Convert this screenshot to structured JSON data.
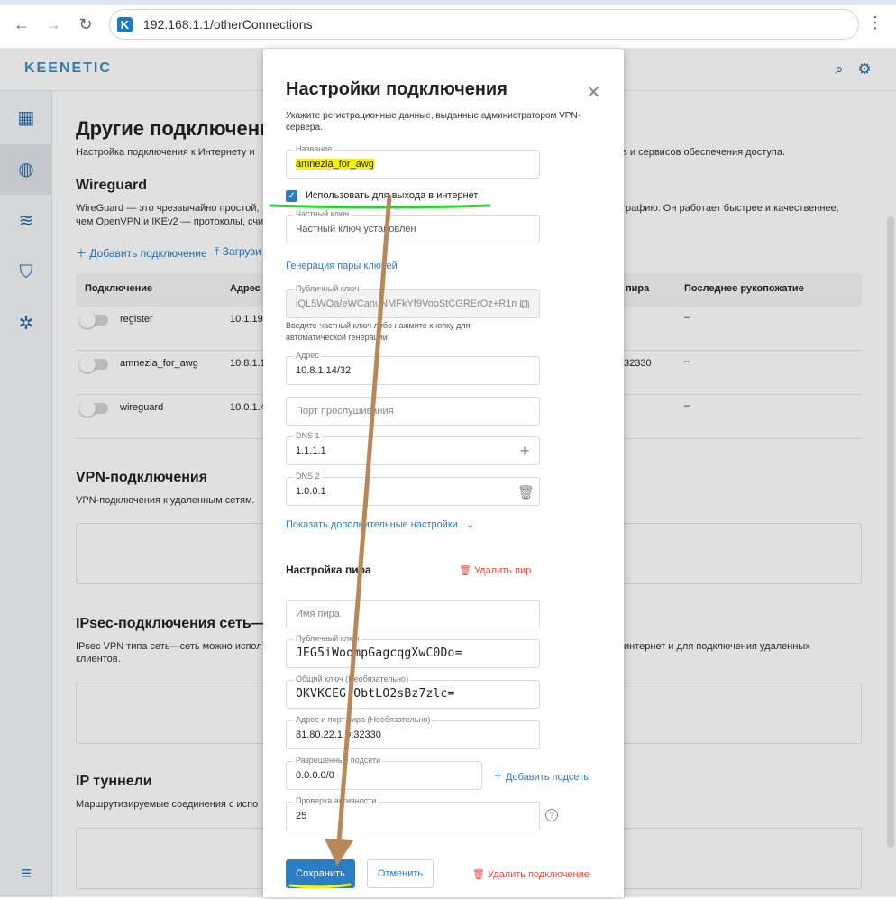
{
  "browser": {
    "back_icon": "arrow-left-icon",
    "forward_icon": "arrow-right-icon",
    "reload_icon": "reload-icon",
    "site_icon_letter": "K",
    "url": "192.168.1.1/otherConnections",
    "menu_icon": "kebab-menu-icon"
  },
  "header": {
    "logo": "KEENETIC",
    "search_icon": "search-icon",
    "settings_icon": "gear-icon"
  },
  "page": {
    "title": "Другие подключени",
    "intro": "Настройка подключения к Интернету и",
    "intro_right": "в и сервисов обеспечения доступа.",
    "wireguard": {
      "title": "Wireguard",
      "desc_line1": "WireGuard — это чрезвычайно простой,",
      "desc_line1_right": "графию. Он работает быстрее и качественнее,",
      "desc_line2": "чем OpenVPN и IKEv2 — протоколы, счи",
      "add_link": "Добавить подключение",
      "load_link": "Загрузи",
      "columns": {
        "connection": "Подключение",
        "address": "Адрес",
        "peer": "пира",
        "handshake": "Последнее рукопожатие"
      },
      "rows": [
        {
          "name": "register",
          "address": "10.1.19",
          "peer": "",
          "handshake": "–"
        },
        {
          "name": "amnezia_for_awg",
          "address": "10.8.1.1",
          "peer": "32330",
          "handshake": "–"
        },
        {
          "name": "wireguard",
          "address": "10.0.1.4",
          "peer": "",
          "handshake": "–"
        }
      ]
    },
    "vpn": {
      "title": "VPN-подключения",
      "desc": "VPN-подключения к удаленным сетям."
    },
    "ipsec": {
      "title": "IPsec-подключения сеть—с",
      "desc_line1": "IPsec VPN типа сеть—сеть можно испол",
      "desc_line1_right": "интернет и для подключения удаленных",
      "desc_line2": "клиентов."
    },
    "tunnels": {
      "title": "IP туннели",
      "desc": "Маршрутизируемые соединения с испо"
    }
  },
  "modal": {
    "title": "Настройки подключения",
    "subtitle": "Укажите регистрационные данные, выданные администратором VPN-сервера.",
    "name_label": "Название",
    "name_value": "amnezia_for_awg",
    "use_internet_label": "Использовать для выхода в интернет",
    "private_key_label": "Частный ключ",
    "private_key_value": "Частный ключ установлен",
    "generate_link": "Генерация пары ключей",
    "public_key_label": "Публичный ключ",
    "public_key_value": "iQL5WOa/eWCanuNMFkYf9VooStCGRErOz+R1m",
    "public_key_hint": "Введите частный ключ либо нажмите кнопку для автоматической генерации.",
    "address_label": "Адрес",
    "address_value": "10.8.1.14/32",
    "listen_port_placeholder": "Порт прослушивания",
    "dns1_label": "DNS 1",
    "dns1_value": "1.1.1.1",
    "dns2_label": "DNS 2",
    "dns2_value": "1.0.0.1",
    "advanced_link": "Показать дополнительные настройки",
    "peer_section": "Настройка пира",
    "delete_peer": "Удалить пир",
    "peer_name_placeholder": "Имя пира",
    "peer_public_key_label": "Публичный ключ",
    "peer_public_key_value": "JEG5iWoompGagcqgXwC0Do=",
    "preshared_label": "Общий ключ (Необязательно)",
    "preshared_value": "OKVKCEG ObtLO2sBz7zlc=",
    "endpoint_label": "Адрес и порт пира (Необязательно)",
    "endpoint_value": "81.80.22.1 0:32330",
    "allowed_label": "Разрешенные подсети",
    "allowed_value": "0.0.0.0/0",
    "add_subnet": "Добавить подсеть",
    "keepalive_label": "Проверка активности",
    "keepalive_value": "25",
    "save": "Сохранить",
    "cancel": "Отменить",
    "delete_connection": "Удалить подключение"
  },
  "colors": {
    "accent": "#2b7dc4",
    "danger": "#e34b3c",
    "highlight": "#f7f20a",
    "annotation_green": "#27d62a",
    "annotation_arrow": "#b8885a"
  }
}
